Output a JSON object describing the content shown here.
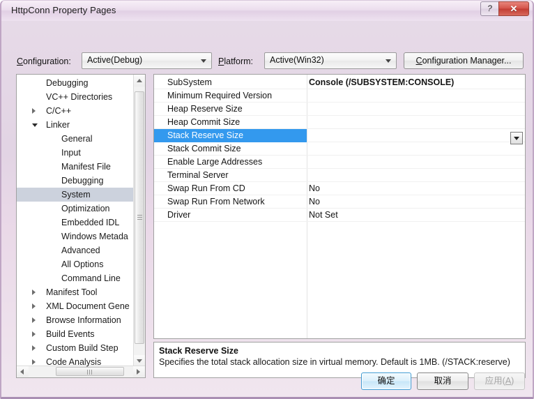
{
  "window": {
    "title": "HttpConn Property Pages",
    "help_button": "?",
    "close_button": "✕"
  },
  "toolbar": {
    "configuration_label_pre": "",
    "configuration_label_acc": "C",
    "configuration_label_post": "onfiguration:",
    "configuration_value": "Active(Debug)",
    "platform_label_acc": "P",
    "platform_label_post": "latform:",
    "platform_value": "Active(Win32)",
    "config_manager_acc": "C",
    "config_manager_pre": "",
    "config_manager_post": "onfiguration Manager..."
  },
  "tree": {
    "items": [
      {
        "label": "Debugging",
        "indent": 42,
        "twisty": "none",
        "selected": false
      },
      {
        "label": "VC++ Directories",
        "indent": 42,
        "twisty": "none",
        "selected": false
      },
      {
        "label": "C/C++",
        "indent": 42,
        "twisty": "collapsed",
        "selected": false
      },
      {
        "label": "Linker",
        "indent": 42,
        "twisty": "expanded",
        "selected": false
      },
      {
        "label": "General",
        "indent": 64,
        "twisty": "none",
        "selected": false
      },
      {
        "label": "Input",
        "indent": 64,
        "twisty": "none",
        "selected": false
      },
      {
        "label": "Manifest File",
        "indent": 64,
        "twisty": "none",
        "selected": false
      },
      {
        "label": "Debugging",
        "indent": 64,
        "twisty": "none",
        "selected": false
      },
      {
        "label": "System",
        "indent": 64,
        "twisty": "none",
        "selected": true
      },
      {
        "label": "Optimization",
        "indent": 64,
        "twisty": "none",
        "selected": false
      },
      {
        "label": "Embedded IDL",
        "indent": 64,
        "twisty": "none",
        "selected": false
      },
      {
        "label": "Windows Metada",
        "indent": 64,
        "twisty": "none",
        "selected": false
      },
      {
        "label": "Advanced",
        "indent": 64,
        "twisty": "none",
        "selected": false
      },
      {
        "label": "All Options",
        "indent": 64,
        "twisty": "none",
        "selected": false
      },
      {
        "label": "Command Line",
        "indent": 64,
        "twisty": "none",
        "selected": false
      },
      {
        "label": "Manifest Tool",
        "indent": 42,
        "twisty": "collapsed",
        "selected": false
      },
      {
        "label": "XML Document Gene",
        "indent": 42,
        "twisty": "collapsed",
        "selected": false
      },
      {
        "label": "Browse Information",
        "indent": 42,
        "twisty": "collapsed",
        "selected": false
      },
      {
        "label": "Build Events",
        "indent": 42,
        "twisty": "collapsed",
        "selected": false
      },
      {
        "label": "Custom Build Step",
        "indent": 42,
        "twisty": "collapsed",
        "selected": false
      },
      {
        "label": "Code Analysis",
        "indent": 42,
        "twisty": "collapsed",
        "selected": false
      }
    ]
  },
  "grid": {
    "rows": [
      {
        "name": "SubSystem",
        "value": "Console (/SUBSYSTEM:CONSOLE)",
        "bold": true,
        "selected": false
      },
      {
        "name": "Minimum Required Version",
        "value": "",
        "bold": false,
        "selected": false
      },
      {
        "name": "Heap Reserve Size",
        "value": "",
        "bold": false,
        "selected": false
      },
      {
        "name": "Heap Commit Size",
        "value": "",
        "bold": false,
        "selected": false
      },
      {
        "name": "Stack Reserve Size",
        "value": "",
        "bold": false,
        "selected": true
      },
      {
        "name": "Stack Commit Size",
        "value": "",
        "bold": false,
        "selected": false
      },
      {
        "name": "Enable Large Addresses",
        "value": "",
        "bold": false,
        "selected": false
      },
      {
        "name": "Terminal Server",
        "value": "",
        "bold": false,
        "selected": false
      },
      {
        "name": "Swap Run From CD",
        "value": "No",
        "bold": false,
        "selected": false
      },
      {
        "name": "Swap Run From Network",
        "value": "No",
        "bold": false,
        "selected": false
      },
      {
        "name": "Driver",
        "value": "Not Set",
        "bold": false,
        "selected": false
      }
    ]
  },
  "description": {
    "title": "Stack Reserve Size",
    "body": "Specifies the total stack allocation size in virtual memory. Default is 1MB. (/STACK:reserve)"
  },
  "footer": {
    "ok_label": "确定",
    "cancel_label": "取消",
    "apply_pre": "应用(",
    "apply_acc": "A",
    "apply_post": ")"
  },
  "colors": {
    "selection_blue": "#3399ee",
    "tree_selection": "#ccd2dd",
    "titlebar": "#e6deea",
    "close_red": "#c23c33"
  }
}
